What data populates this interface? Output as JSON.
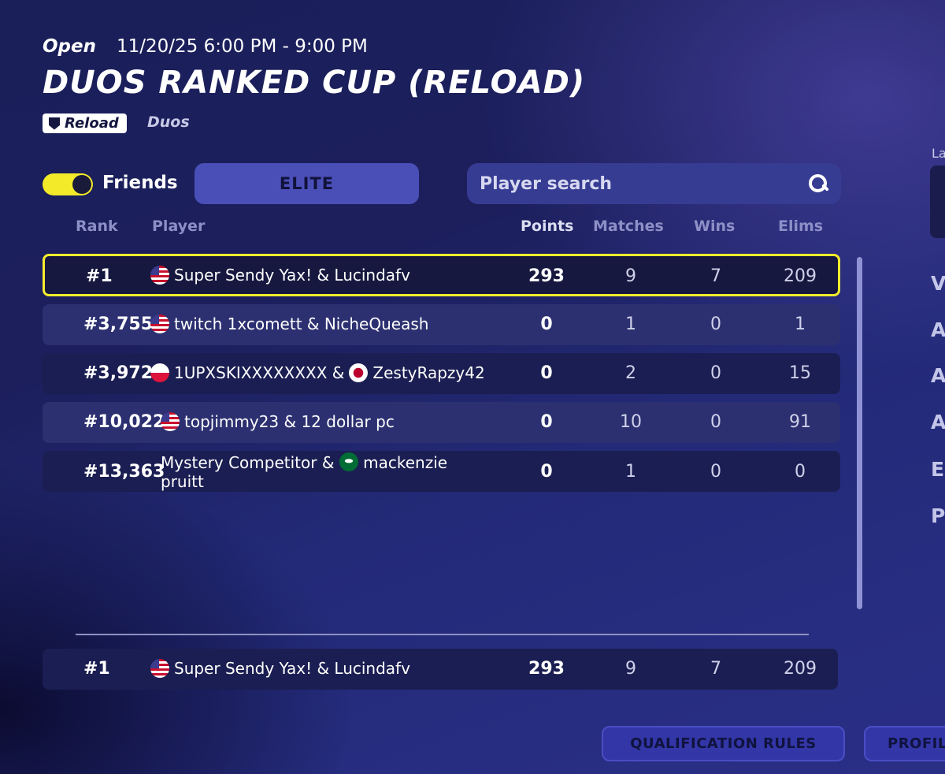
{
  "event": {
    "status": "Open",
    "datetime": "11/20/25 6:00 PM - 9:00 PM",
    "title": "DUOS RANKED CUP (RELOAD)",
    "badge": "Reload",
    "mode": "Duos"
  },
  "controls": {
    "friends_label": "Friends",
    "friends_toggle_on": true,
    "division_button": "ELITE",
    "search_placeholder": "Player search"
  },
  "table": {
    "headers": {
      "rank": "Rank",
      "player": "Player",
      "points": "Points",
      "matches": "Matches",
      "wins": "Wins",
      "elims": "Elims"
    },
    "rows": [
      {
        "rank": "#1",
        "player": "Super Sendy Yax! & Lucindafv",
        "points": "293",
        "matches": "9",
        "wins": "7",
        "elims": "209",
        "highlighted": true,
        "flags": [
          "us"
        ]
      },
      {
        "rank": "#3,755",
        "player": "twitch 1xcomett & NicheQueash",
        "points": "0",
        "matches": "1",
        "wins": "0",
        "elims": "1",
        "flags": [
          "us"
        ]
      },
      {
        "rank": "#3,972",
        "player_a": "1UPXSKIXXXXXXXX &",
        "player_b": "ZestyRapzy42",
        "points": "0",
        "matches": "2",
        "wins": "0",
        "elims": "15",
        "flags": [
          "pl",
          "jp"
        ]
      },
      {
        "rank": "#10,022",
        "player": "topjimmy23 & 12 dollar pc",
        "points": "0",
        "matches": "10",
        "wins": "0",
        "elims": "91",
        "flags": [
          "us"
        ]
      },
      {
        "rank": "#13,363",
        "player_a": "Mystery Competitor &",
        "player_b": "mackenzie",
        "player_c": "pruitt",
        "points": "0",
        "matches": "1",
        "wins": "0",
        "elims": "0",
        "flags": [
          "sa"
        ]
      }
    ],
    "self_row": {
      "rank": "#1",
      "player": "Super Sendy Yax! & Lucindafv",
      "points": "293",
      "matches": "9",
      "wins": "7",
      "elims": "209",
      "flags": [
        "us"
      ]
    }
  },
  "footer": {
    "qualification_button": "QUALIFICATION RULES",
    "profile_button": "PROFIL"
  },
  "side_panel": {
    "label": "La",
    "letters": [
      "V",
      "A",
      "A",
      "A",
      "E",
      "P"
    ]
  },
  "colors": {
    "highlight": "#f5ec2c",
    "toggle_on": "#f3ea2a",
    "button_bg": "#4a4fb8"
  }
}
